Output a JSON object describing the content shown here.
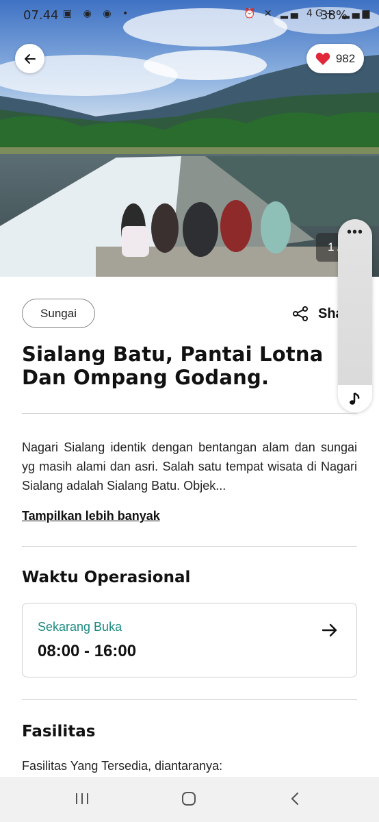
{
  "status_bar": {
    "time": "07.44",
    "battery": "38%",
    "network": "4G+"
  },
  "hero": {
    "likes": "982",
    "counter": "1 /"
  },
  "category_chip": "Sungai",
  "share_label": "Share",
  "title": "Sialang Batu, Pantai Lotna Dan Ompang Godang.",
  "description": "Nagari Sialang identik dengan bentangan alam dan sungai yg masih alami dan asri. Salah satu tempat wisata di Nagari Sialang adalah Sialang Batu. Objek...",
  "show_more": "Tampilkan lebih banyak",
  "operational": {
    "heading": "Waktu Operasional",
    "status": "Sekarang Buka",
    "hours": "08:00 - 16:00"
  },
  "facilities": {
    "heading": "Fasilitas",
    "intro": "Fasilitas Yang Tersedia, diantaranya:"
  },
  "colors": {
    "accent_open": "#1b8a80",
    "heart": "#e0283a"
  },
  "icons": [
    "back-arrow-icon",
    "heart-icon",
    "share-icon",
    "more-dots-icon",
    "music-note-icon",
    "arrow-right-icon",
    "recent-apps-icon",
    "home-icon",
    "back-nav-icon"
  ]
}
